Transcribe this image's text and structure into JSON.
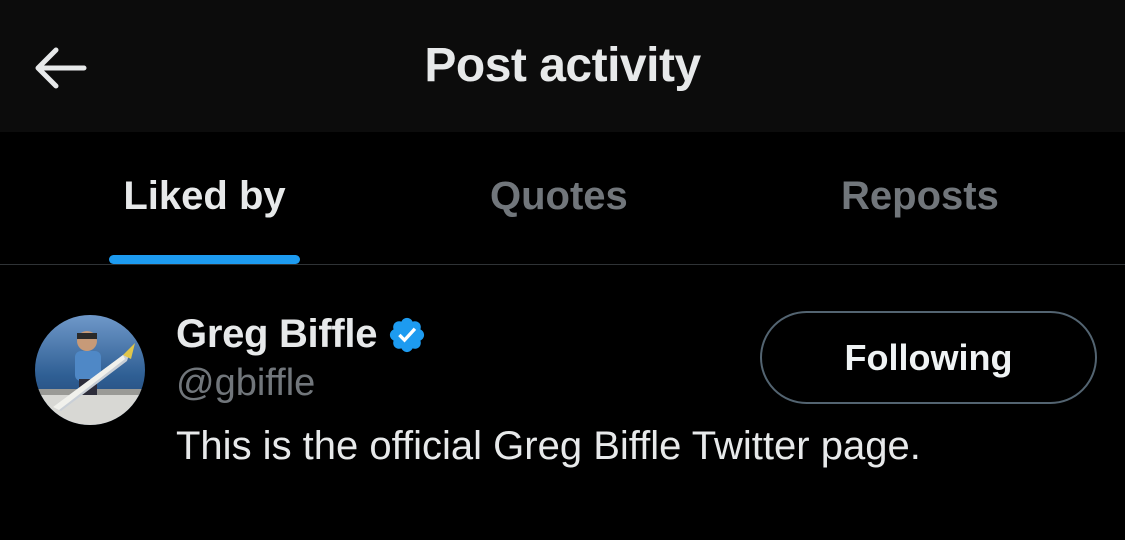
{
  "header": {
    "title": "Post activity",
    "back_icon": "arrow-left-icon"
  },
  "tabs": [
    {
      "label": "Liked by",
      "active": true
    },
    {
      "label": "Quotes",
      "active": false
    },
    {
      "label": "Reposts",
      "active": false
    }
  ],
  "users": [
    {
      "name": "Greg Biffle",
      "verified": true,
      "handle": "@gbiffle",
      "bio": "This is the official Greg Biffle Twitter page.",
      "follow_label": "Following",
      "avatar_icon": "avatar-photo"
    }
  ],
  "colors": {
    "background": "#000000",
    "header_background": "#0c0c0c",
    "accent": "#1d9bf0",
    "text_primary": "#e7e9ea",
    "text_secondary": "#71767b",
    "divider": "#2f3336"
  }
}
